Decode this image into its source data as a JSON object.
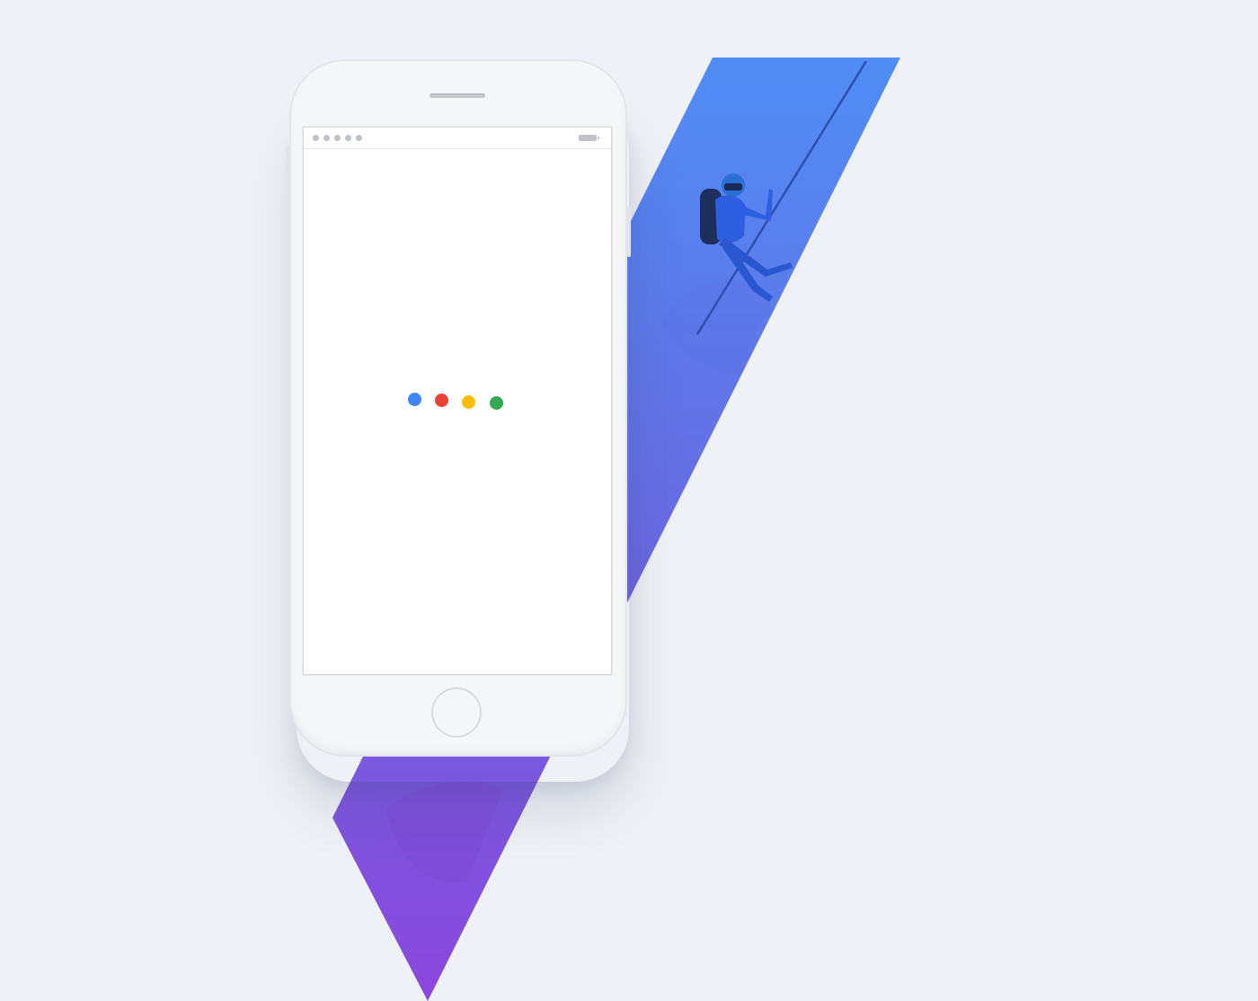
{
  "scene": {
    "background_color": "#eef1f5",
    "ribbon_colors": {
      "top": "#4f8df5",
      "middle": "#6b67e0",
      "bottom": "#8b47dd"
    },
    "illustration": "rock-climber-on-rope"
  },
  "device": {
    "type": "smartphone",
    "body_color": "#f5f6f8",
    "status_bar": {
      "signal_dot_count": 5,
      "battery_icon": "battery-icon"
    },
    "screen": {
      "background_color": "#ffffff",
      "state": "loading",
      "loader": {
        "icon": "google-loading-dots",
        "dots": [
          {
            "color": "#4285f4",
            "name": "blue"
          },
          {
            "color": "#ea4335",
            "name": "red"
          },
          {
            "color": "#fbbc05",
            "name": "yellow"
          },
          {
            "color": "#34a853",
            "name": "green"
          }
        ]
      }
    }
  }
}
